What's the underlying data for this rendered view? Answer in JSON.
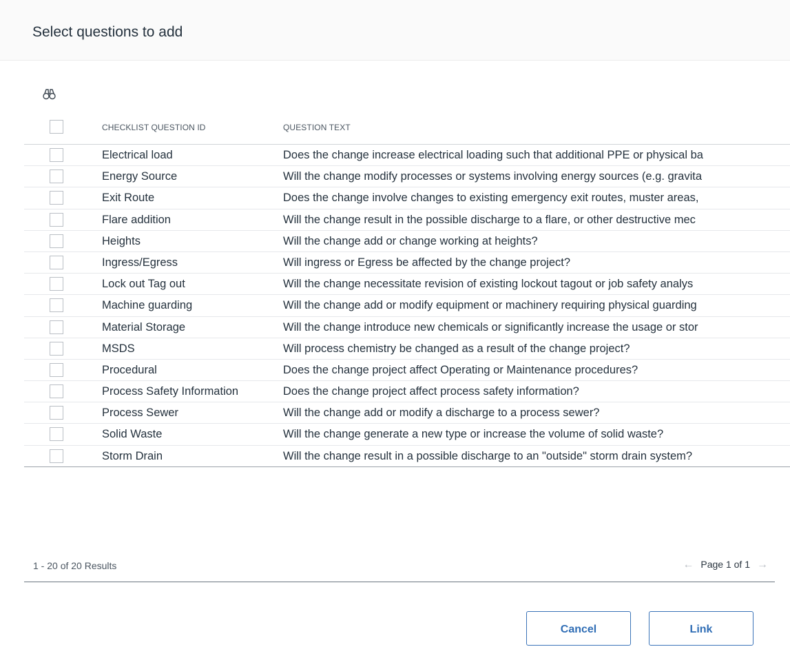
{
  "dialog": {
    "title": "Select questions to add"
  },
  "toolbar": {
    "find_icon": "binoculars-icon"
  },
  "table": {
    "columns": [
      "CHECKLIST QUESTION ID",
      "QUESTION TEXT"
    ],
    "rows": [
      {
        "id": "Electrical load",
        "text": "Does the change increase electrical loading such that additional PPE or physical ba"
      },
      {
        "id": "Energy Source",
        "text": "Will the change modify processes or systems involving energy sources (e.g. gravita"
      },
      {
        "id": "Exit Route",
        "text": "Does the change involve changes to existing emergency exit routes, muster areas,"
      },
      {
        "id": "Flare addition",
        "text": "Will the change result in the possible discharge to a flare, or other destructive mec"
      },
      {
        "id": "Heights",
        "text": "Will the change add or change working at heights?"
      },
      {
        "id": "Ingress/Egress",
        "text": "Will ingress or Egress be affected by the change project?"
      },
      {
        "id": "Lock out Tag out",
        "text": "Will the change necessitate revision of existing lockout tagout or job safety analys"
      },
      {
        "id": "Machine guarding",
        "text": "Will the change add or modify equipment or machinery requiring physical guarding"
      },
      {
        "id": "Material Storage",
        "text": "Will the change introduce new chemicals or significantly increase the usage or stor"
      },
      {
        "id": "MSDS",
        "text": "Will process chemistry be changed as a result of the change project?"
      },
      {
        "id": "Procedural",
        "text": "Does the change project affect Operating or Maintenance procedures?"
      },
      {
        "id": "Process Safety Information",
        "text": "Does the change project affect process safety information?"
      },
      {
        "id": "Process Sewer",
        "text": "Will the change add or modify a discharge to a process sewer?"
      },
      {
        "id": "Solid Waste",
        "text": "Will the change generate a new type or increase the volume of solid waste?"
      },
      {
        "id": "Storm Drain",
        "text": "Will the change result in a possible discharge to an \"outside\" storm drain system?"
      }
    ]
  },
  "footer": {
    "results": "1 - 20 of 20 Results",
    "page": "Page 1 of 1",
    "prev_arrow": "←",
    "next_arrow": "→"
  },
  "buttons": {
    "cancel": "Cancel",
    "link": "Link"
  }
}
